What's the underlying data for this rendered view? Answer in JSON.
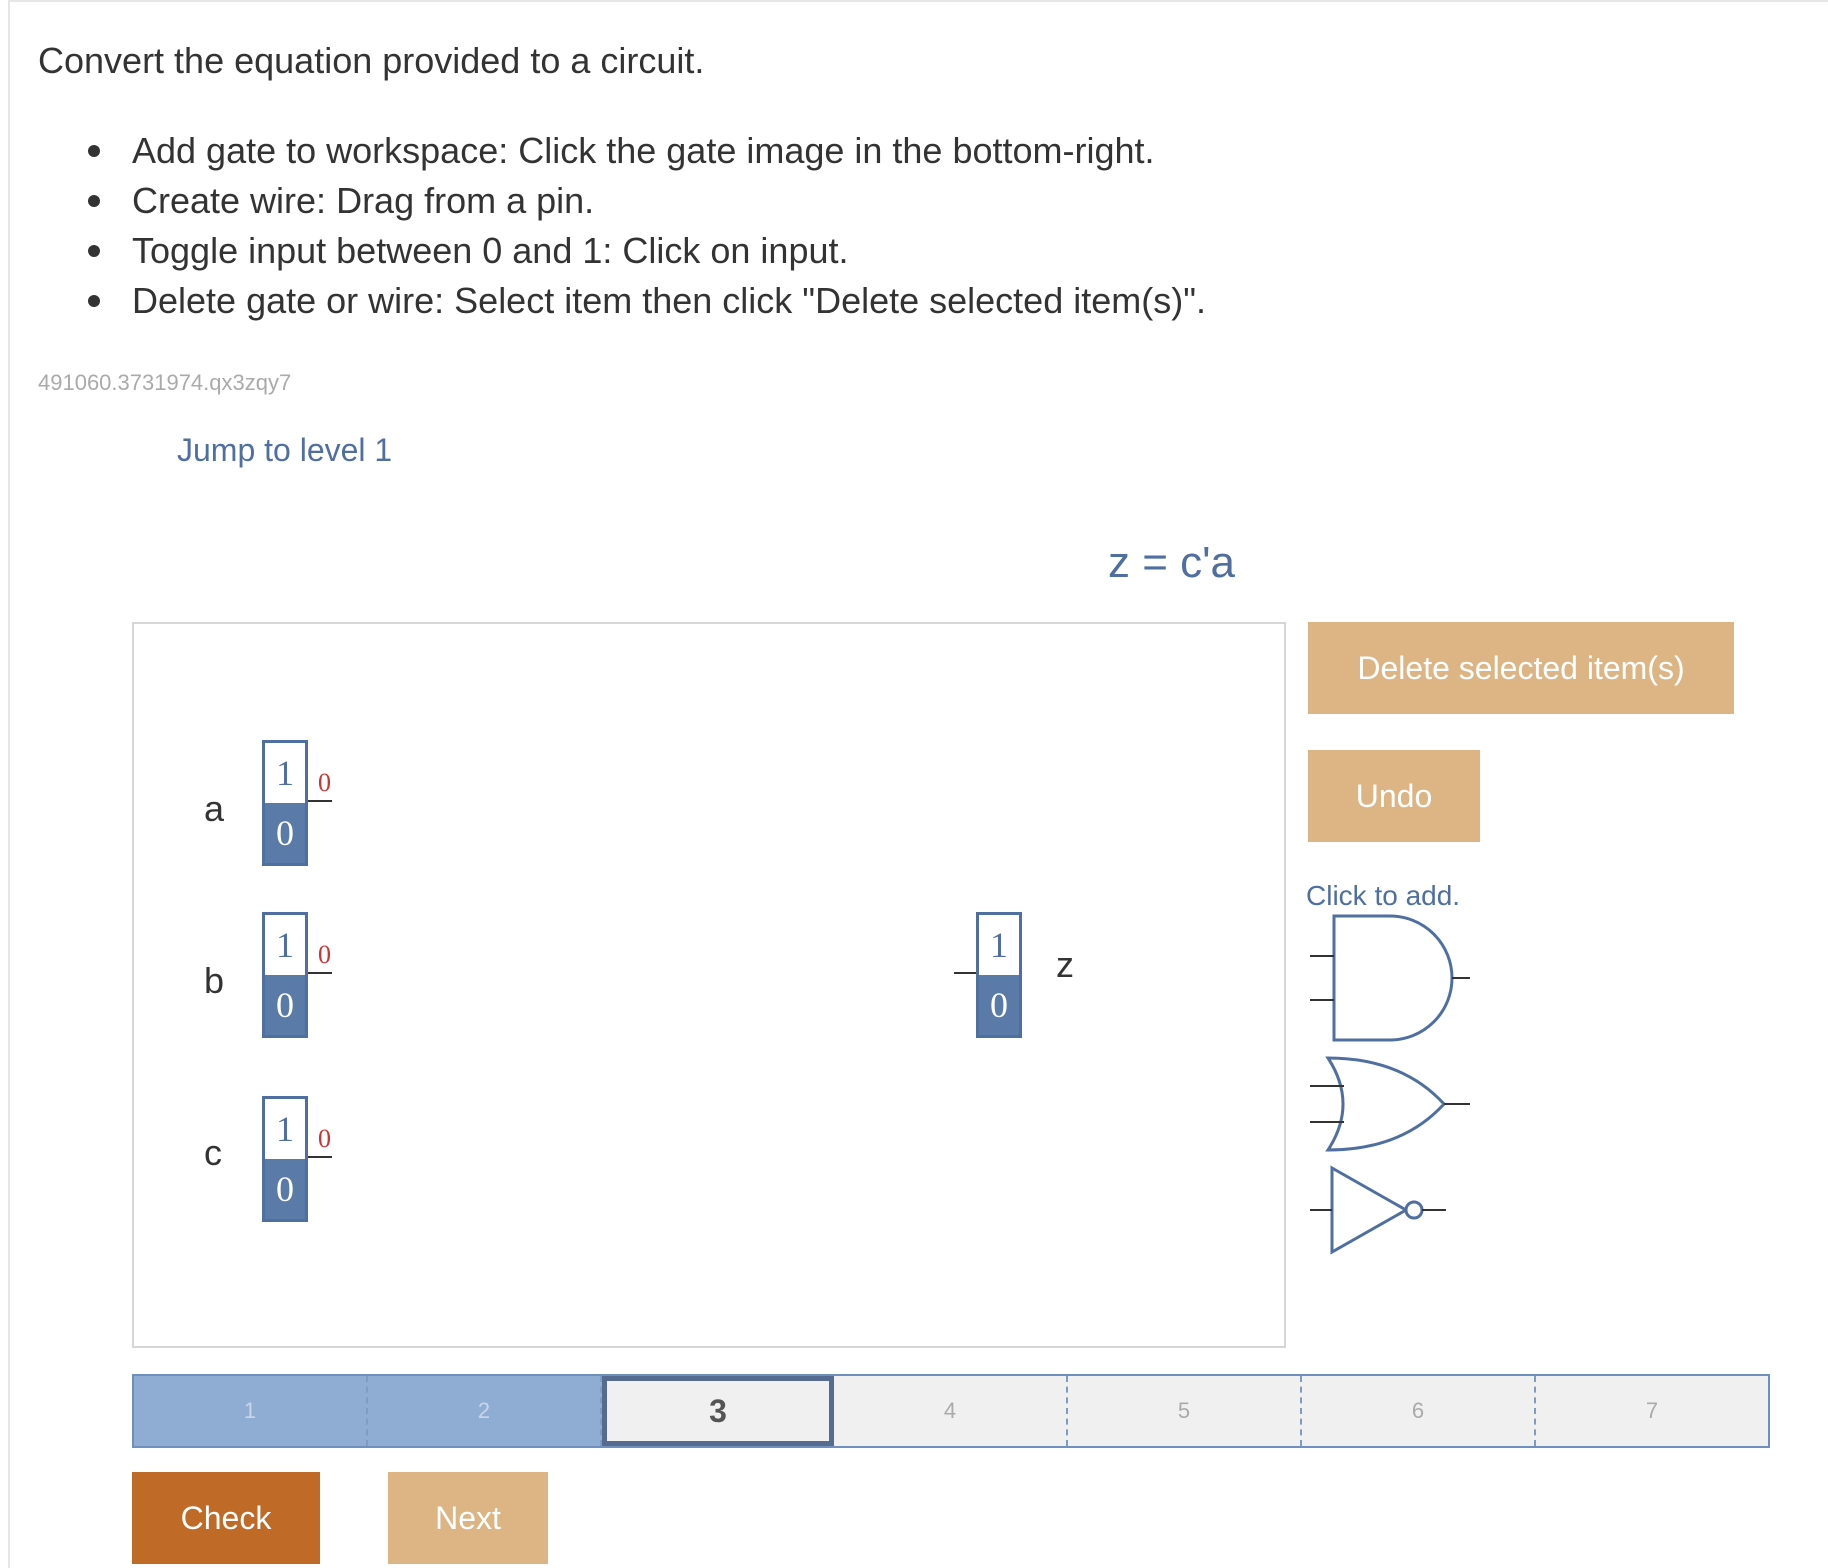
{
  "instructions": {
    "title": "Convert the equation provided to a circuit.",
    "steps": [
      "Add gate to workspace: Click the gate image in the bottom-right.",
      "Create wire: Drag from a pin.",
      "Toggle input between 0 and 1: Click on input.",
      "Delete gate or wire: Select item then click \"Delete selected item(s)\"."
    ]
  },
  "activity_id": "491060.3731974.qx3zqy7",
  "jump_link": "Jump to level 1",
  "equation": "z = c'a",
  "inputs": [
    {
      "name": "a",
      "one": "1",
      "zero": "0",
      "value": "0"
    },
    {
      "name": "b",
      "one": "1",
      "zero": "0",
      "value": "0"
    },
    {
      "name": "c",
      "one": "1",
      "zero": "0",
      "value": "0"
    }
  ],
  "output": {
    "name": "z",
    "one": "1",
    "zero": "0"
  },
  "controls": {
    "delete_label": "Delete selected item(s)",
    "undo_label": "Undo",
    "click_to_add": "Click to add."
  },
  "gates": [
    "and-gate-icon",
    "or-gate-icon",
    "not-gate-icon"
  ],
  "progress": {
    "levels": [
      "1",
      "2",
      "3",
      "4",
      "5",
      "6",
      "7"
    ],
    "current": 3,
    "completed": 2
  },
  "buttons": {
    "check": "Check",
    "next": "Next"
  },
  "colors": {
    "accent": "#4f6fa1",
    "check": "#c06a28",
    "secondary": "#ddb585",
    "bit_out": "#cc3333"
  }
}
